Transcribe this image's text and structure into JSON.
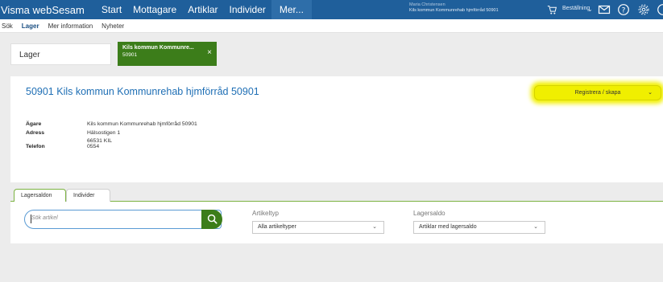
{
  "topbar": {
    "brand": "Visma webSesam",
    "nav": [
      "Start",
      "Mottagare",
      "Artiklar",
      "Individer",
      "Mer..."
    ],
    "user_name": "Maria Christensen",
    "user_org": "Kils kommun Kommunrehab hjmförråd 50901",
    "order_label": "Beställning"
  },
  "subnav": [
    "Sök",
    "Lager",
    "Mer information",
    "Nyheter"
  ],
  "lager_label": "Lager",
  "open_tab": {
    "title": "Kils kommun Kommunre...",
    "subtitle": "50901",
    "close": "×"
  },
  "panel": {
    "title": "50901 Kils kommun Kommunrehab hjmförråd 50901",
    "register_button": "Registrera / skapa",
    "owner_label": "Ägare",
    "owner_value": "Kils kommun Kommunrehab hjmförråd 50901",
    "address_label": "Adress",
    "address_line1": "Hälsostigen 1",
    "address_line2": "66531 KIL",
    "phone_label": "Telefon",
    "phone_value": "0554"
  },
  "tabs": [
    "Lagersaldon",
    "Individer"
  ],
  "filters": {
    "search_placeholder": "Sök artikel",
    "type_label": "Artikeltyp",
    "type_value": "Alla artikeltyper",
    "saldo_label": "Lagersaldo",
    "saldo_value": "Artiklar med lagersaldo"
  },
  "colors": {
    "topbar": "#1f5f9b",
    "accent_green": "#3c7d1a",
    "title_blue": "#1f6fb5",
    "highlight": "#f0ef00"
  }
}
